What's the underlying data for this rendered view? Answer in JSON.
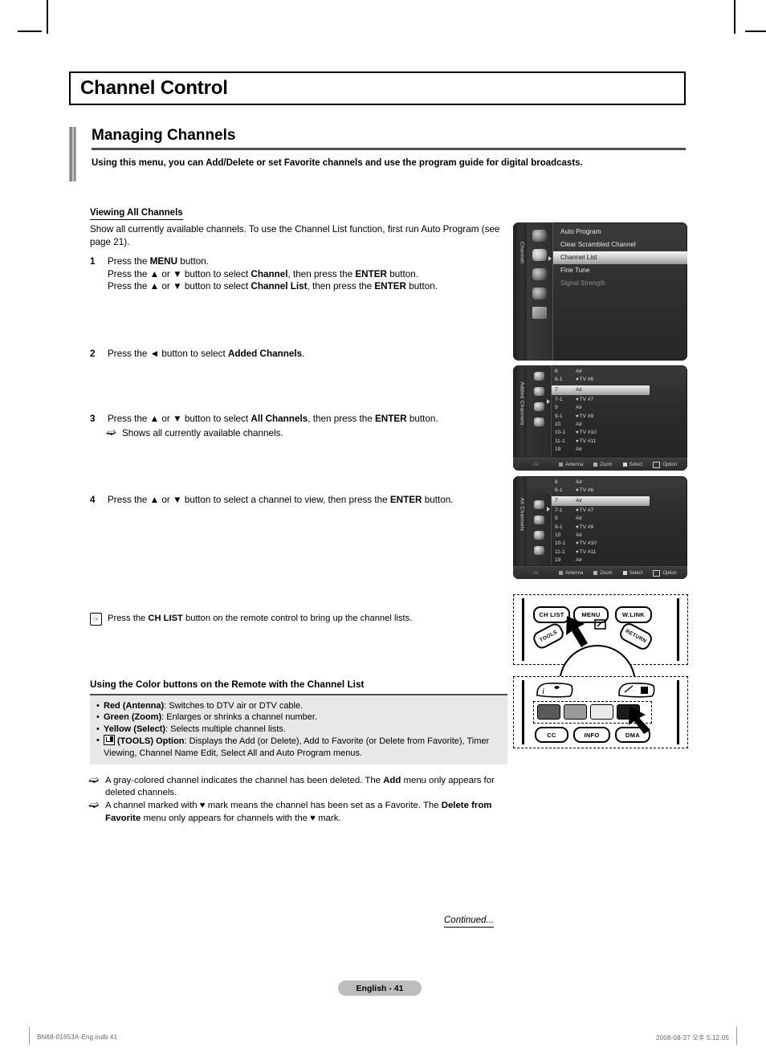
{
  "page": {
    "title": "Channel Control",
    "section_title": "Managing Channels",
    "section_subtitle": "Using this menu, you can Add/Delete or set Favorite channels and use the program guide for digital broadcasts.",
    "page_label": "English - 41",
    "continued": "Continued...",
    "print_left": "BN68-01653A-Eng.indb   41",
    "print_right": "2008-08-27   오후 5:12:05"
  },
  "body": {
    "subhead": "Viewing All Channels",
    "intro": "Show all currently available channels. To use the Channel List function, first run Auto Program (see page 21).",
    "steps": [
      {
        "num": "1",
        "lines": [
          [
            {
              "t": "Press the "
            },
            {
              "t": "MENU",
              "b": true
            },
            {
              "t": " button."
            }
          ],
          [
            {
              "t": "Press the ▲ or ▼ button to select "
            },
            {
              "t": "Channel",
              "b": true
            },
            {
              "t": ", then press the "
            },
            {
              "t": "ENTER",
              "b": true
            },
            {
              "t": " button."
            }
          ],
          [
            {
              "t": "Press the ▲ or ▼ button to select "
            },
            {
              "t": "Channel List",
              "b": true
            },
            {
              "t": ", then press the "
            },
            {
              "t": "ENTER",
              "b": true
            },
            {
              "t": " button."
            }
          ]
        ]
      },
      {
        "num": "2",
        "lines": [
          [
            {
              "t": "Press the ◄ button to select "
            },
            {
              "t": "Added Channels",
              "b": true
            },
            {
              "t": "."
            }
          ]
        ]
      },
      {
        "num": "3",
        "lines": [
          [
            {
              "t": "Press the ▲ or ▼ button to select "
            },
            {
              "t": "All Channels",
              "b": true
            },
            {
              "t": ", then press the "
            },
            {
              "t": "ENTER",
              "b": true
            },
            {
              "t": " button."
            }
          ]
        ],
        "note": "Shows all currently available channels."
      },
      {
        "num": "4",
        "lines": [
          [
            {
              "t": "Press the ▲ or ▼ button to select a channel to view, then press the "
            },
            {
              "t": "ENTER",
              "b": true
            },
            {
              "t": " button."
            }
          ]
        ]
      }
    ],
    "chlist_note": [
      {
        "t": "Press the "
      },
      {
        "t": "CH LIST",
        "b": true
      },
      {
        "t": " button on the remote control to bring up the channel lists."
      }
    ],
    "color_section": {
      "heading": "Using the Color buttons on the Remote with the Channel List",
      "items": [
        [
          {
            "t": "Red (Antenna)",
            "b": true
          },
          {
            "t": ": Switches to DTV air or DTV cable."
          }
        ],
        [
          {
            "t": "Green (Zoom)",
            "b": true
          },
          {
            "t": ": Enlarges or shrinks a channel number."
          }
        ],
        [
          {
            "t": "Yellow (Select)",
            "b": true
          },
          {
            "t": ": Selects multiple channel lists."
          }
        ],
        [
          {
            "t": "(TOOLS) Option",
            "b": true
          },
          {
            "t": ": Displays the Add (or Delete), Add to Favorite (or Delete from Favorite), Timer Viewing, Channel Name Edit, Select All and Auto Program menus."
          }
        ]
      ]
    },
    "notes": [
      [
        {
          "t": "A gray-colored channel indicates the channel has been deleted. The "
        },
        {
          "t": "Add",
          "b": true
        },
        {
          "t": " menu only appears for deleted channels."
        }
      ],
      [
        {
          "t": "A channel marked with ♥ mark means the channel has been set as a Favorite. The "
        },
        {
          "t": "Delete from Favorite",
          "b": true
        },
        {
          "t": " menu only appears for channels with the ♥ mark."
        }
      ]
    ]
  },
  "osd": {
    "menu": {
      "tab_label": "Channel",
      "items": [
        {
          "label": "Auto Program",
          "state": "normal"
        },
        {
          "label": "Clear Scrambled Channel",
          "state": "normal"
        },
        {
          "label": "Channel List",
          "state": "highlighted"
        },
        {
          "label": "Fine Tune",
          "state": "normal"
        },
        {
          "label": "Signal Strength",
          "state": "disabled"
        }
      ]
    },
    "added_channels": {
      "tab_label": "Added Channels",
      "rows": [
        {
          "num": "6",
          "name": "Air",
          "fav": false,
          "sel": false
        },
        {
          "num": "6-1",
          "name": "TV #6",
          "fav": true,
          "sel": false
        },
        {
          "num": "7",
          "name": "Air",
          "fav": false,
          "sel": true
        },
        {
          "num": "7-1",
          "name": "TV #7",
          "fav": true,
          "sel": false
        },
        {
          "num": "9",
          "name": "Air",
          "fav": false,
          "sel": false
        },
        {
          "num": "9-1",
          "name": "TV #9",
          "fav": true,
          "sel": false
        },
        {
          "num": "10",
          "name": "Air",
          "fav": false,
          "sel": false
        },
        {
          "num": "10-1",
          "name": "TV #10",
          "fav": true,
          "sel": false
        },
        {
          "num": "11-1",
          "name": "TV #11",
          "fav": true,
          "sel": false
        },
        {
          "num": "19",
          "name": "Air",
          "fav": false,
          "sel": false
        }
      ],
      "footer": {
        "mode": "Air",
        "buttons": [
          {
            "color": "red",
            "label": "Antenna"
          },
          {
            "color": "green",
            "label": "Zoom"
          },
          {
            "color": "yellow",
            "label": "Select"
          },
          {
            "color": "tools",
            "label": "Option"
          }
        ]
      }
    },
    "all_channels": {
      "tab_label": "All Channels",
      "rows": [
        {
          "num": "6",
          "name": "Air",
          "fav": false,
          "sel": false
        },
        {
          "num": "6-1",
          "name": "TV #6",
          "fav": true,
          "sel": false
        },
        {
          "num": "7",
          "name": "Air",
          "fav": false,
          "sel": true
        },
        {
          "num": "7-1",
          "name": "TV #7",
          "fav": true,
          "sel": false
        },
        {
          "num": "9",
          "name": "Air",
          "fav": false,
          "sel": false
        },
        {
          "num": "9-1",
          "name": "TV #9",
          "fav": true,
          "sel": false
        },
        {
          "num": "10",
          "name": "Air",
          "fav": false,
          "sel": false
        },
        {
          "num": "10-1",
          "name": "TV #10",
          "fav": true,
          "sel": false
        },
        {
          "num": "11-1",
          "name": "TV #11",
          "fav": true,
          "sel": false
        },
        {
          "num": "19",
          "name": "Air",
          "fav": false,
          "sel": false
        }
      ],
      "footer": {
        "mode": "Air",
        "buttons": [
          {
            "color": "red",
            "label": "Antenna"
          },
          {
            "color": "green",
            "label": "Zoom"
          },
          {
            "color": "yellow",
            "label": "Select"
          },
          {
            "color": "tools",
            "label": "Option"
          }
        ]
      }
    }
  },
  "remote_top": {
    "buttons": [
      "CH LIST",
      "MENU",
      "W.LINK",
      "TOOLS",
      "RETURN"
    ]
  },
  "remote_bottom": {
    "buttons": [
      "CC",
      "INFO",
      "DMA"
    ],
    "color_keys": [
      "red",
      "green",
      "yellow",
      "blue"
    ]
  },
  "colors": {
    "rule": "#4d4d4d",
    "panel_bg": "#e8e8e8",
    "pill_bg": "#bdbdbd",
    "osd_bg": "#2b2b2b",
    "osd_highlight": "#d2d2d2"
  }
}
